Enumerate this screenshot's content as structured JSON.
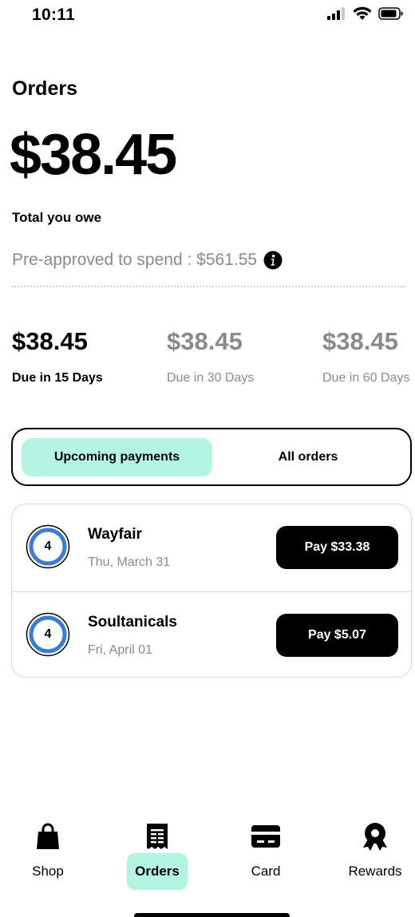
{
  "status_bar": {
    "time": "10:11"
  },
  "page": {
    "title": "Orders",
    "total_amount": "$38.45",
    "total_label": "Total you owe",
    "preapproved": "Pre-approved to spend : $561.55"
  },
  "due": [
    {
      "amount": "$38.45",
      "label": "Due in 15 Days"
    },
    {
      "amount": "$38.45",
      "label": "Due in 30 Days"
    },
    {
      "amount": "$38.45",
      "label": "Due in 60 Days"
    }
  ],
  "tabs": {
    "upcoming": "Upcoming payments",
    "all": "All orders"
  },
  "orders": [
    {
      "count": "4",
      "merchant": "Wayfair",
      "date": "Thu, March 31",
      "pay_label": "Pay $33.38"
    },
    {
      "count": "4",
      "merchant": "Soultanicals",
      "date": "Fri, April 01",
      "pay_label": "Pay $5.07"
    }
  ],
  "nav": [
    {
      "label": "Shop",
      "icon": "shopping-bag-icon"
    },
    {
      "label": "Orders",
      "icon": "receipt-icon"
    },
    {
      "label": "Card",
      "icon": "credit-card-icon"
    },
    {
      "label": "Rewards",
      "icon": "award-ribbon-icon"
    }
  ],
  "colors": {
    "accent": "#b3f5e2",
    "badge_ring": "#3a7bd5",
    "muted_text": "#8a8a8a"
  }
}
